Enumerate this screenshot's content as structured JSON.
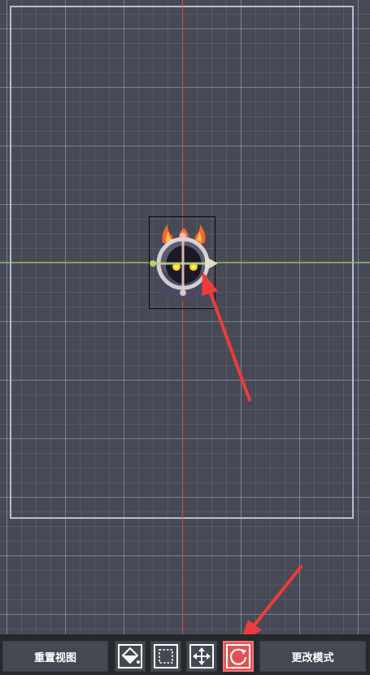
{
  "toolbar": {
    "reset_view_label": "重置视图",
    "change_mode_label": "更改模式",
    "tools": [
      {
        "icon": "fill-tool-icon",
        "active": false
      },
      {
        "icon": "marquee-select-icon",
        "active": false
      },
      {
        "icon": "move-tool-icon",
        "active": false
      },
      {
        "icon": "rotate-tool-icon",
        "active": true
      }
    ]
  },
  "colors": {
    "canvas_bg": "#474a55",
    "grid_line": "#aab2c6",
    "bounds_border": "#b4bfd8",
    "axis_vertical": "#e04848",
    "axis_horizontal": "#8cc02a",
    "active_tool": "#e25151",
    "annotation_arrow": "#ee3b3b",
    "toolbar_bg": "#26282c",
    "button_bg": "#454850"
  }
}
